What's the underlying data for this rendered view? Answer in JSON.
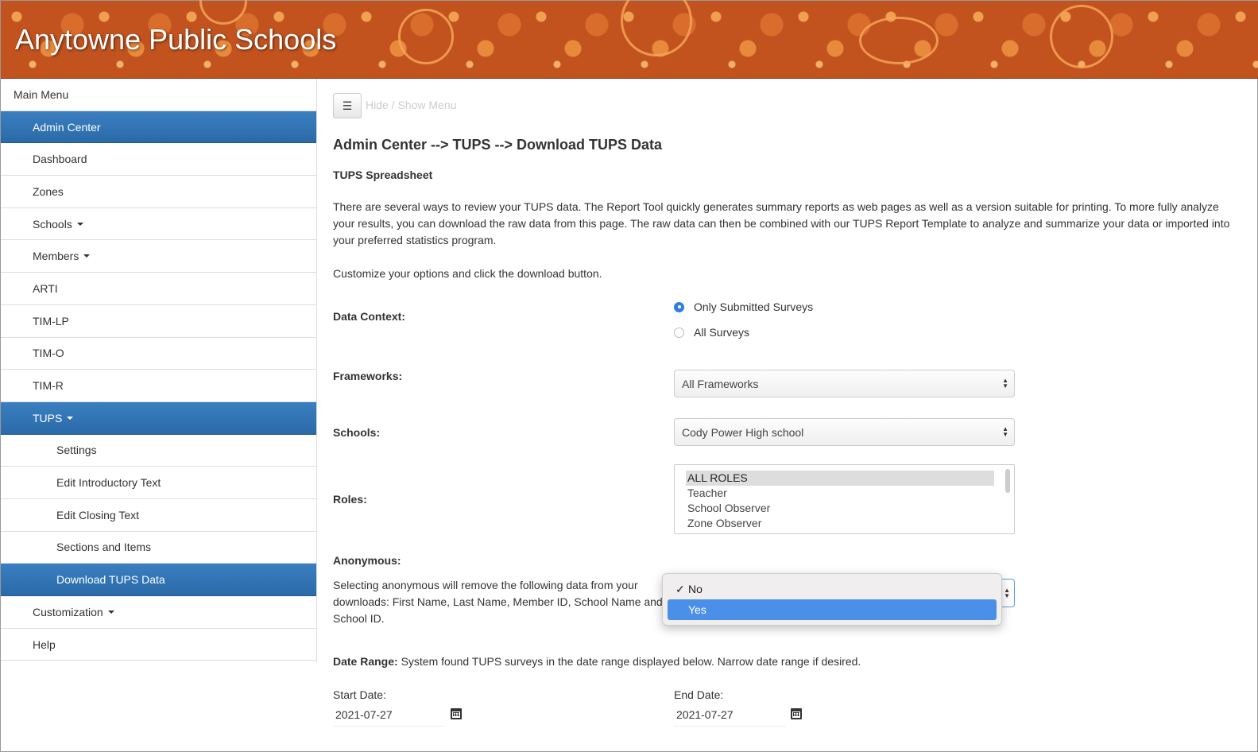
{
  "header": {
    "title": "Anytowne Public Schools"
  },
  "sidebar": {
    "items": [
      {
        "label": "Main Menu"
      },
      {
        "label": "Admin Center"
      },
      {
        "label": "Dashboard"
      },
      {
        "label": "Zones"
      },
      {
        "label": "Schools"
      },
      {
        "label": "Members"
      },
      {
        "label": "ARTI"
      },
      {
        "label": "TIM-LP"
      },
      {
        "label": "TIM-O"
      },
      {
        "label": "TIM-R"
      },
      {
        "label": "TUPS"
      },
      {
        "label": "Settings"
      },
      {
        "label": "Edit Introductory Text"
      },
      {
        "label": "Edit Closing Text"
      },
      {
        "label": "Sections and Items"
      },
      {
        "label": "Download TUPS Data"
      },
      {
        "label": "Customization"
      },
      {
        "label": "Help"
      }
    ]
  },
  "main": {
    "toggle_icon": "☰",
    "toggle_label": "Hide / Show Menu",
    "page_title": "Admin Center --> TUPS --> Download TUPS Data",
    "section_title": "TUPS Spreadsheet",
    "intro": "There are several ways to review your TUPS data. The Report Tool quickly generates summary reports as web pages as well as a version suitable for printing. To more fully analyze your results, you can download the raw data from this page. The raw data can then be combined with our TUPS Report Template to analyze and summarize your data or imported into your preferred statistics program.",
    "instructions": "Customize your options and click the download button.",
    "data_context": {
      "label": "Data Context:",
      "options": [
        "Only Submitted Surveys",
        "All Surveys"
      ],
      "selected": "Only Submitted Surveys"
    },
    "frameworks": {
      "label": "Frameworks:",
      "value": "All Frameworks"
    },
    "schools": {
      "label": "Schools:",
      "value": "Cody Power High school"
    },
    "roles": {
      "label": "Roles:",
      "options": [
        "ALL ROLES",
        "Teacher",
        "School Observer",
        "Zone Observer"
      ],
      "selected": "ALL ROLES"
    },
    "anonymous": {
      "label": "Anonymous:",
      "description": "Selecting anonymous will remove the following data from your downloads: First Name, Last Name, Member ID, School Name and School ID.",
      "options": [
        "No",
        "Yes"
      ],
      "checked": "No",
      "highlighted": "Yes",
      "check_mark": "✓"
    },
    "date_range": {
      "label": "Date Range:",
      "text": " System found TUPS surveys in the date range displayed below. Narrow date range if desired.",
      "start_label": "Start Date:",
      "start_value": "2021-07-27",
      "end_label": "End Date:",
      "end_value": "2021-07-27"
    }
  },
  "colors": {
    "active_nav": "#2f74b5",
    "banner": "#c2531f",
    "highlight": "#4a90e8"
  }
}
